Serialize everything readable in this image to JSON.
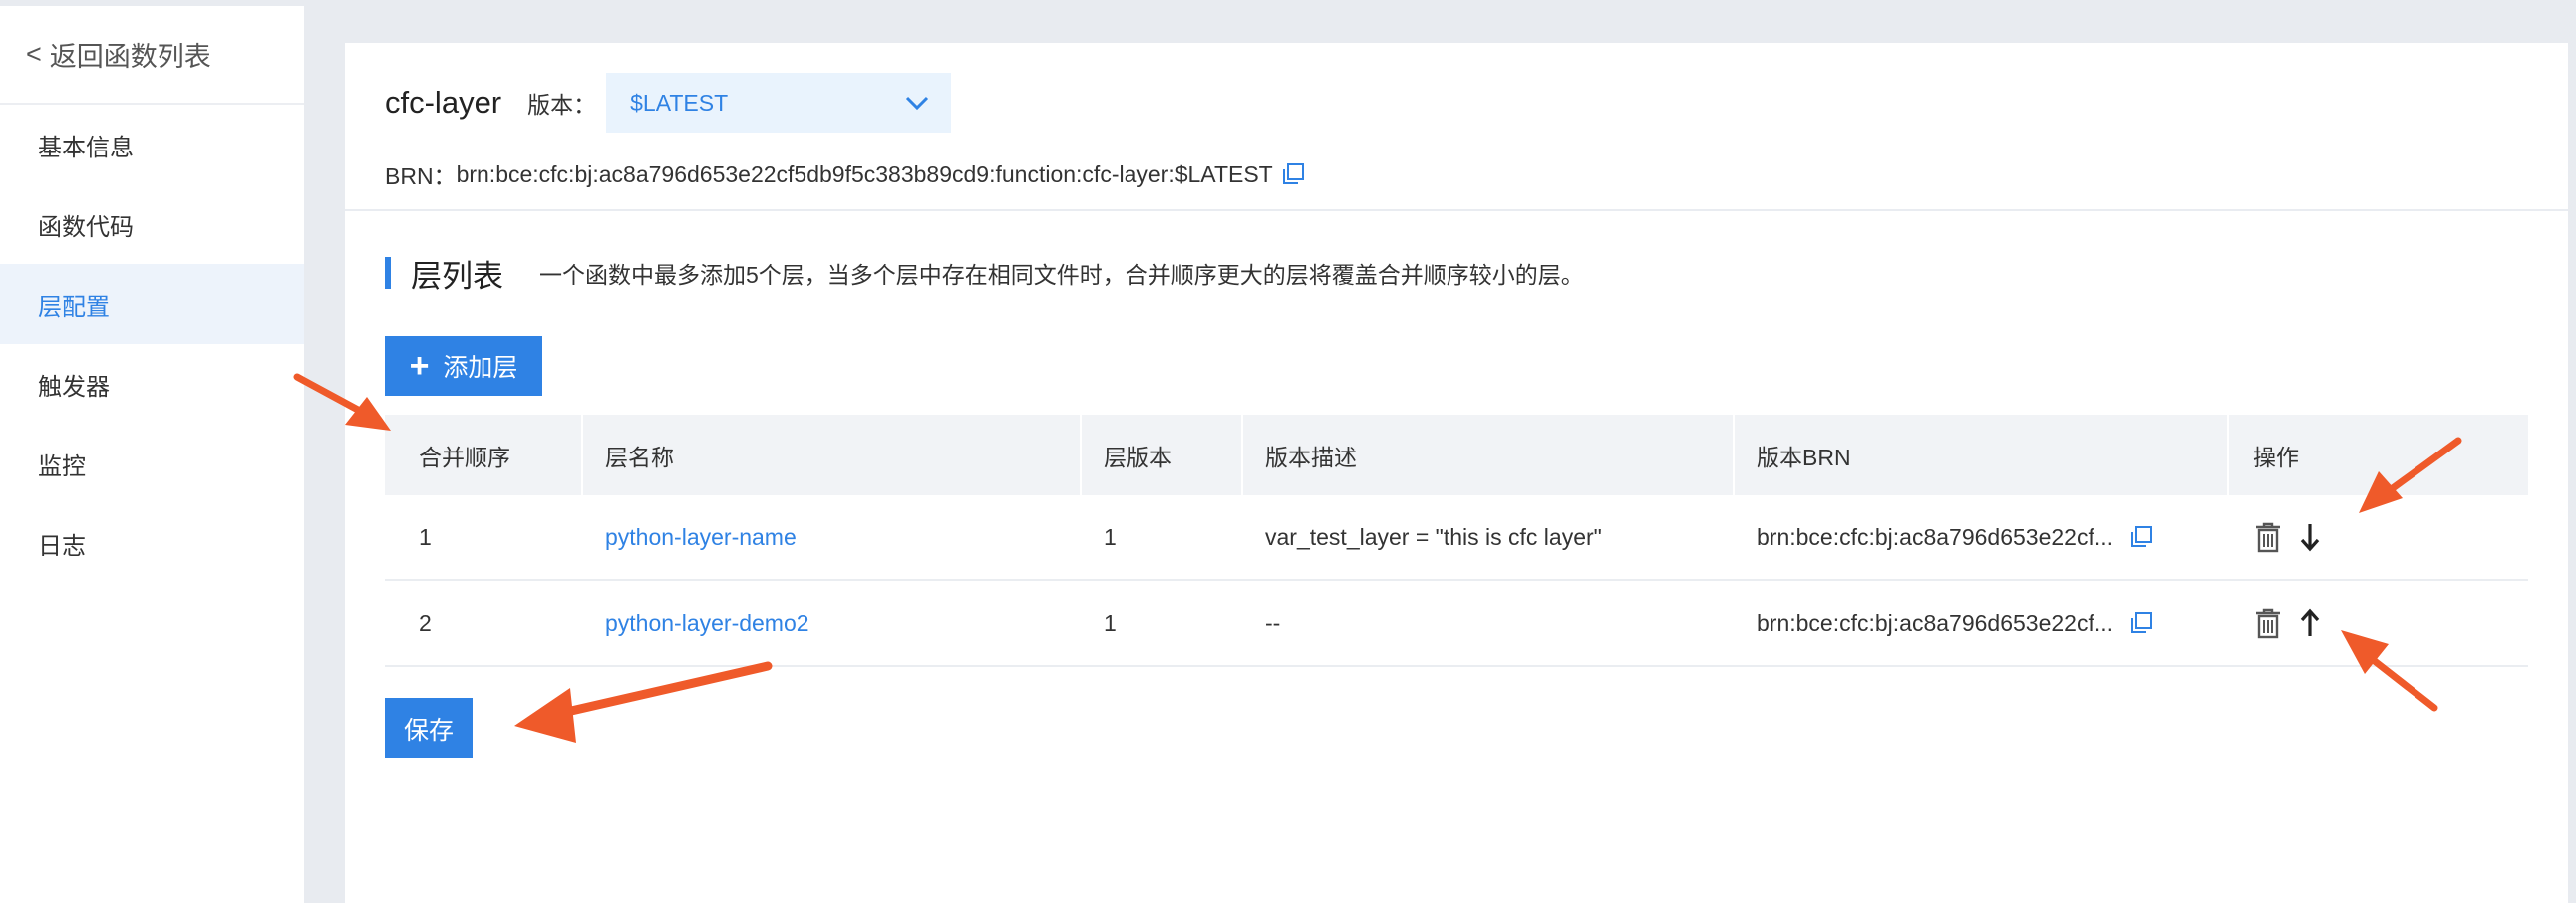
{
  "sidebar": {
    "back_chevron": "<",
    "back_label": "返回函数列表",
    "items": [
      {
        "label": "基本信息"
      },
      {
        "label": "函数代码"
      },
      {
        "label": "层配置"
      },
      {
        "label": "触发器"
      },
      {
        "label": "监控"
      },
      {
        "label": "日志"
      }
    ],
    "active_index": 2
  },
  "header": {
    "function_name": "cfc-layer",
    "version_label": "版本：",
    "version_value": "$LATEST",
    "brn_label": "BRN：",
    "brn_value": "brn:bce:cfc:bj:ac8a796d653e22cf5db9f5c383b89cd9:function:cfc-layer:$LATEST"
  },
  "section": {
    "title": "层列表",
    "description": "一个函数中最多添加5个层，当多个层中存在相同文件时，合并顺序更大的层将覆盖合并顺序较小的层。"
  },
  "add_button": {
    "icon": "plus-icon",
    "label": "添加层"
  },
  "table": {
    "headers": [
      "合并顺序",
      "层名称",
      "层版本",
      "版本描述",
      "版本BRN",
      "操作"
    ],
    "rows": [
      {
        "order": "1",
        "name": "python-layer-name",
        "version": "1",
        "description": "var_test_layer = \"this is cfc layer\"",
        "brn": "brn:bce:cfc:bj:ac8a796d653e22cf...",
        "move_icon": "arrow-down-icon"
      },
      {
        "order": "2",
        "name": "python-layer-demo2",
        "version": "1",
        "description": "--",
        "brn": "brn:bce:cfc:bj:ac8a796d653e22cf...",
        "move_icon": "arrow-up-icon"
      }
    ]
  },
  "save_button": {
    "label": "保存"
  },
  "colors": {
    "accent": "#2f82e4",
    "background": "#e8ebf0",
    "annotation_arrow": "#ef5a2a"
  }
}
